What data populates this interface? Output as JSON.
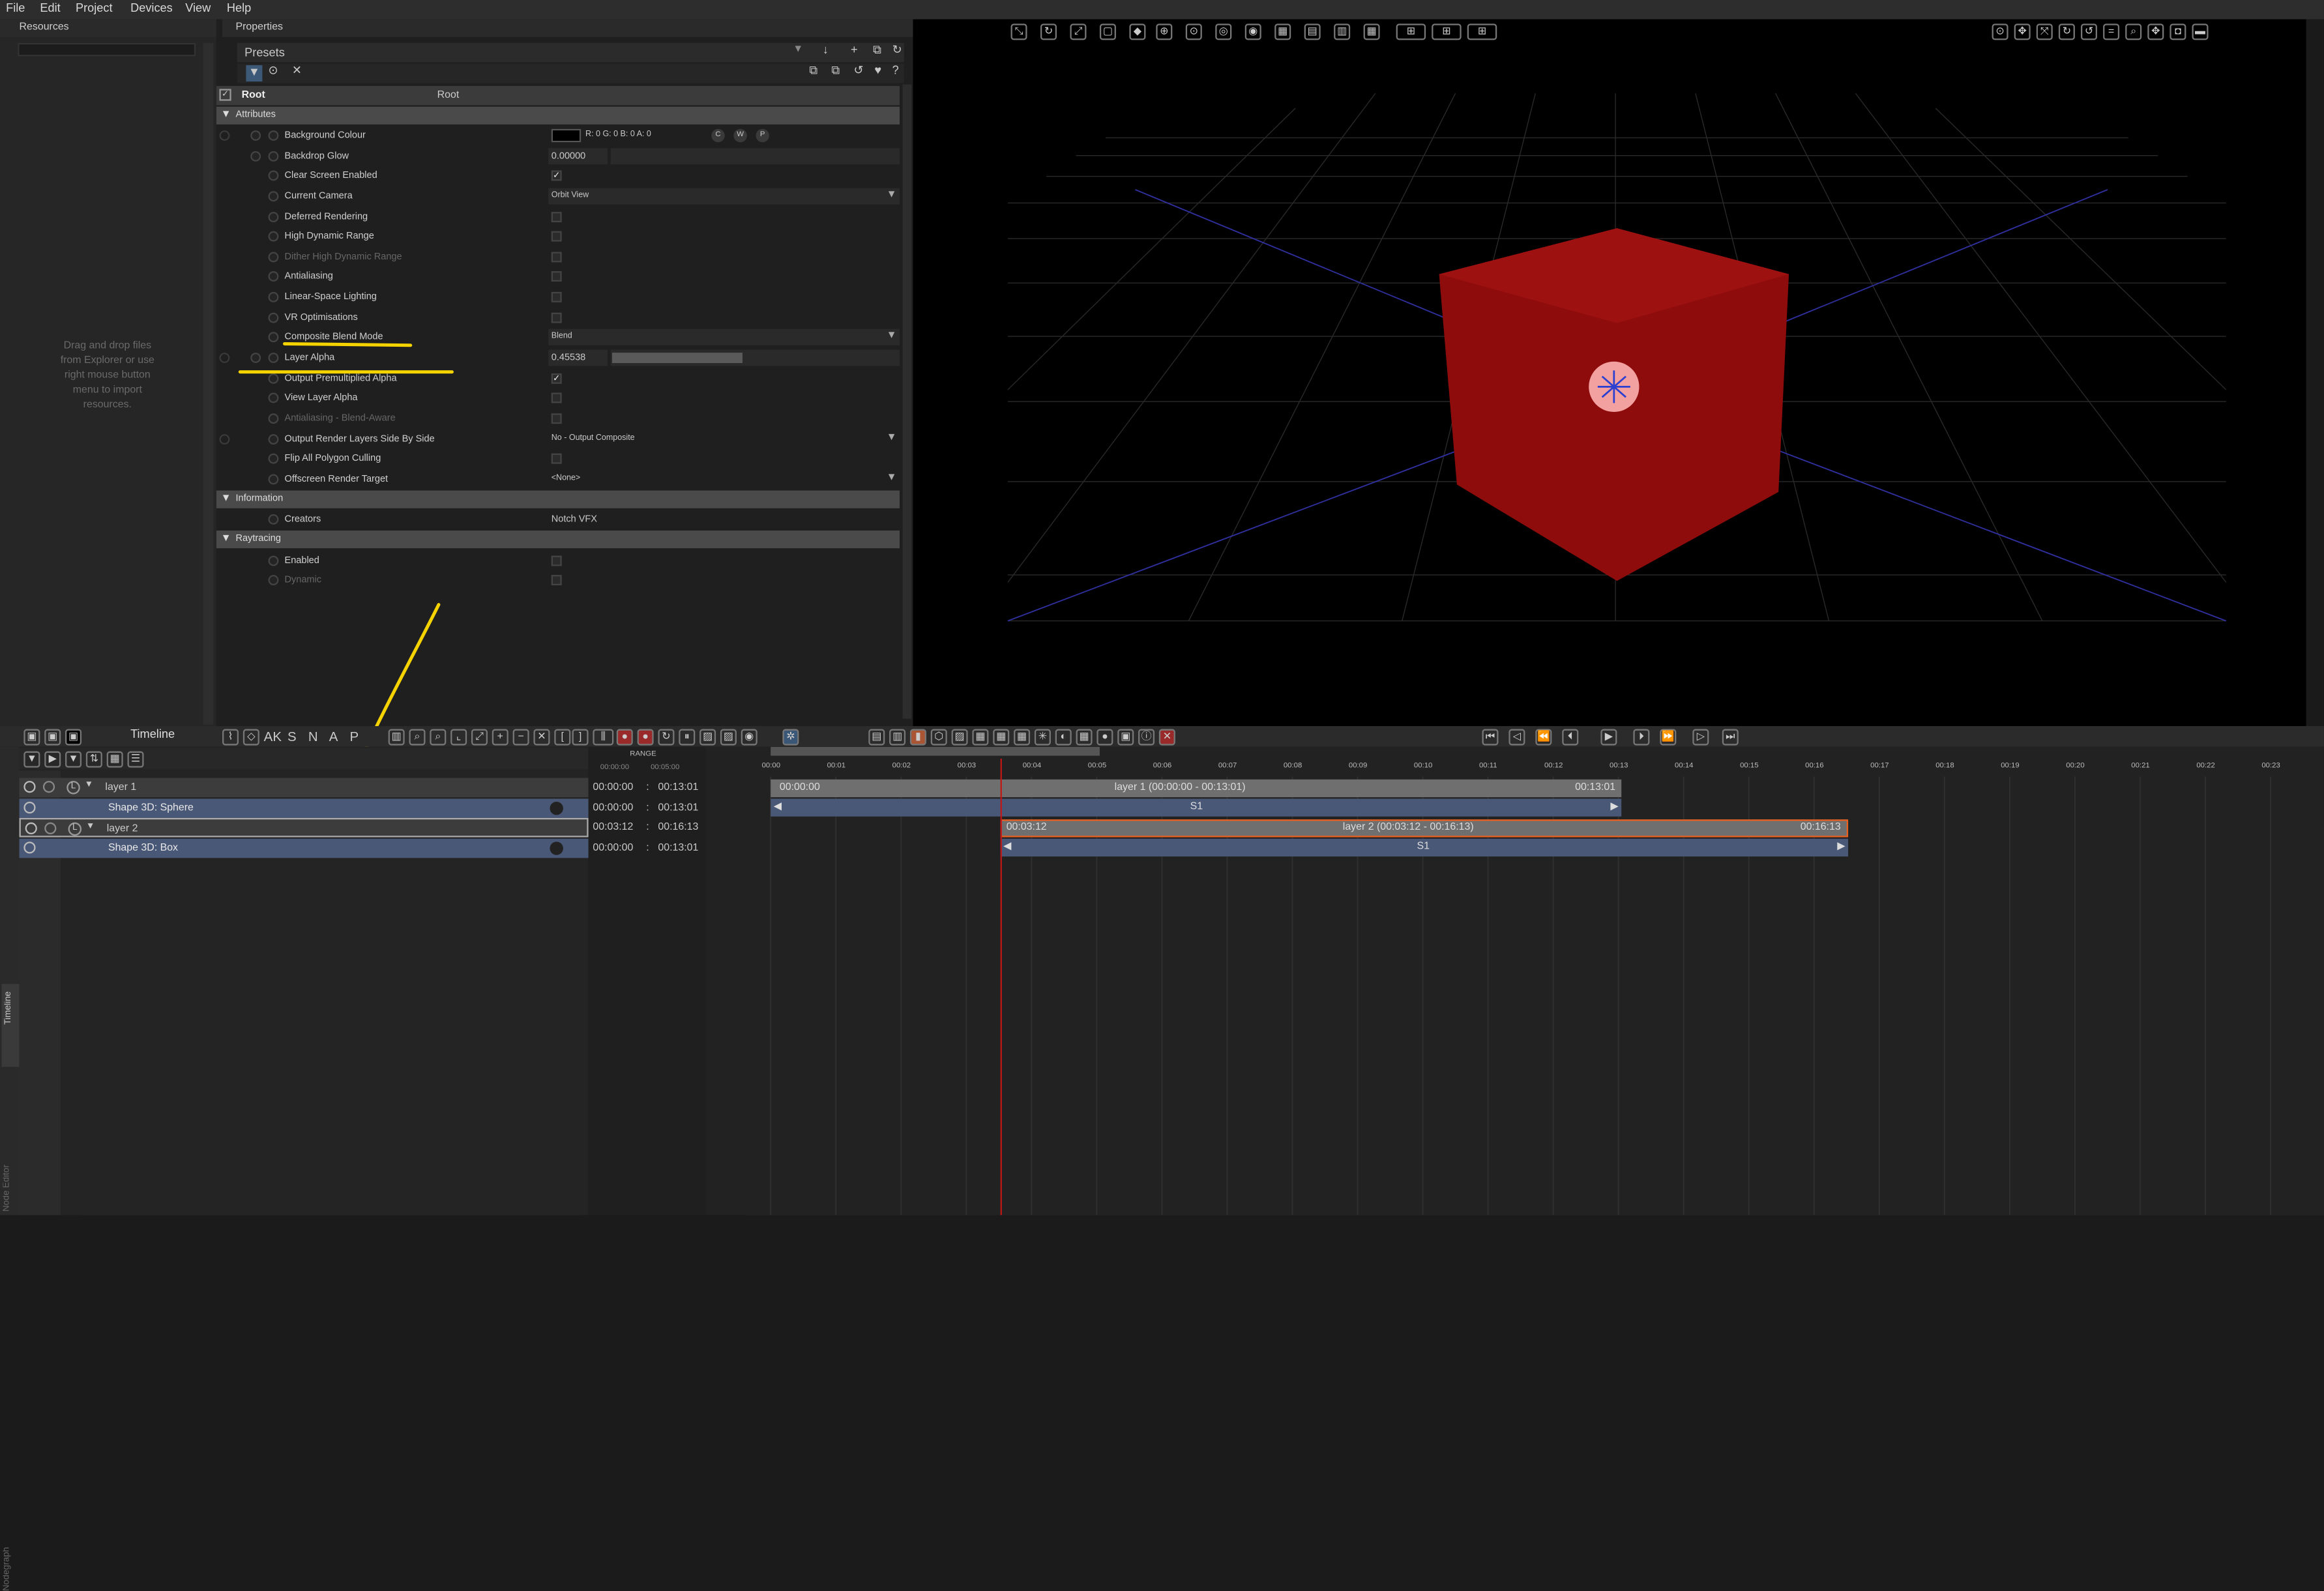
{
  "menu": [
    "File",
    "Edit",
    "Project",
    "Devices",
    "View",
    "Help"
  ],
  "resources": {
    "title": "Resources",
    "hint_lines": [
      "Drag and drop files",
      "from Explorer or use",
      "right mouse button",
      "menu to import",
      "resources."
    ]
  },
  "properties": {
    "title": "Properties",
    "presets": "Presets",
    "root_name": "Root",
    "root_type": "Root",
    "sections": {
      "attributes": "Attributes",
      "information": "Information",
      "raytracing": "Raytracing"
    },
    "attrs": [
      {
        "label": "Background Colour",
        "value": "R: 0 G: 0 B: 0 A: 0"
      },
      {
        "label": "Backdrop Glow",
        "value": "0.00000"
      },
      {
        "label": "Clear Screen Enabled",
        "value": "✓"
      },
      {
        "label": "Current Camera",
        "value": "Orbit View"
      },
      {
        "label": "Deferred Rendering",
        "value": ""
      },
      {
        "label": "High Dynamic Range",
        "value": ""
      },
      {
        "label": "Dither High Dynamic Range",
        "value": ""
      },
      {
        "label": "Antialiasing",
        "value": ""
      },
      {
        "label": "Linear-Space Lighting",
        "value": ""
      },
      {
        "label": "VR Optimisations",
        "value": ""
      },
      {
        "label": "Composite Blend Mode",
        "value": "Blend"
      },
      {
        "label": "Layer Alpha",
        "value": "0.45538"
      },
      {
        "label": "Output Premultiplied Alpha",
        "value": "✓"
      },
      {
        "label": "View Layer Alpha",
        "value": ""
      },
      {
        "label": "Antialiasing - Blend-Aware",
        "value": ""
      },
      {
        "label": "Output Render Layers Side By Side",
        "value": "No - Output Composite"
      },
      {
        "label": "Flip All Polygon Culling",
        "value": ""
      },
      {
        "label": "Offscreen Render Target",
        "value": "<None>"
      }
    ],
    "color_btns": [
      "C",
      "W",
      "P"
    ],
    "layer_alpha_fraction": 0.45538,
    "info": [
      {
        "label": "Creators",
        "value": "Notch VFX"
      }
    ],
    "ray": [
      {
        "label": "Enabled",
        "value": ""
      },
      {
        "label": "Dynamic",
        "value": ""
      }
    ]
  },
  "timeline": {
    "title": "Timeline",
    "snap": [
      "AK",
      "S",
      "N",
      "A",
      "P"
    ],
    "range": "RANGE",
    "range_vals": [
      "00:00:00",
      "00:05:00"
    ],
    "ruler": [
      "00:00",
      "00:01",
      "00:02",
      "00:03",
      "00:04",
      "00:05",
      "00:06",
      "00:07",
      "00:08",
      "00:09",
      "00:10",
      "00:11",
      "00:12",
      "00:13",
      "00:14",
      "00:15",
      "00:16",
      "00:17",
      "00:18",
      "00:19",
      "00:20",
      "00:21",
      "00:22",
      "00:23"
    ],
    "rows": [
      {
        "name": "layer  1",
        "start": "00:00:00",
        "end": "00:13:01"
      },
      {
        "name": "Shape  3D:  Sphere",
        "start": "00:00:00",
        "end": "00:13:01"
      },
      {
        "name": "layer  2",
        "start": "00:03:12",
        "end": "00:16:13"
      },
      {
        "name": "Shape  3D:  Box",
        "start": "00:00:00",
        "end": "00:13:01"
      }
    ],
    "clips": [
      {
        "left": "00:00:00",
        "mid": "layer  1  (00:00:00  -  00:13:01)",
        "right": "00:13:01",
        "sub": "S1"
      },
      {
        "left": "00:03:12",
        "mid": "layer  2  (00:03:12  -  00:16:13)",
        "right": "00:16:13",
        "sub": "S1"
      }
    ],
    "side_tabs": [
      "Nodegraph",
      "Timeline",
      "Node Editor"
    ]
  }
}
